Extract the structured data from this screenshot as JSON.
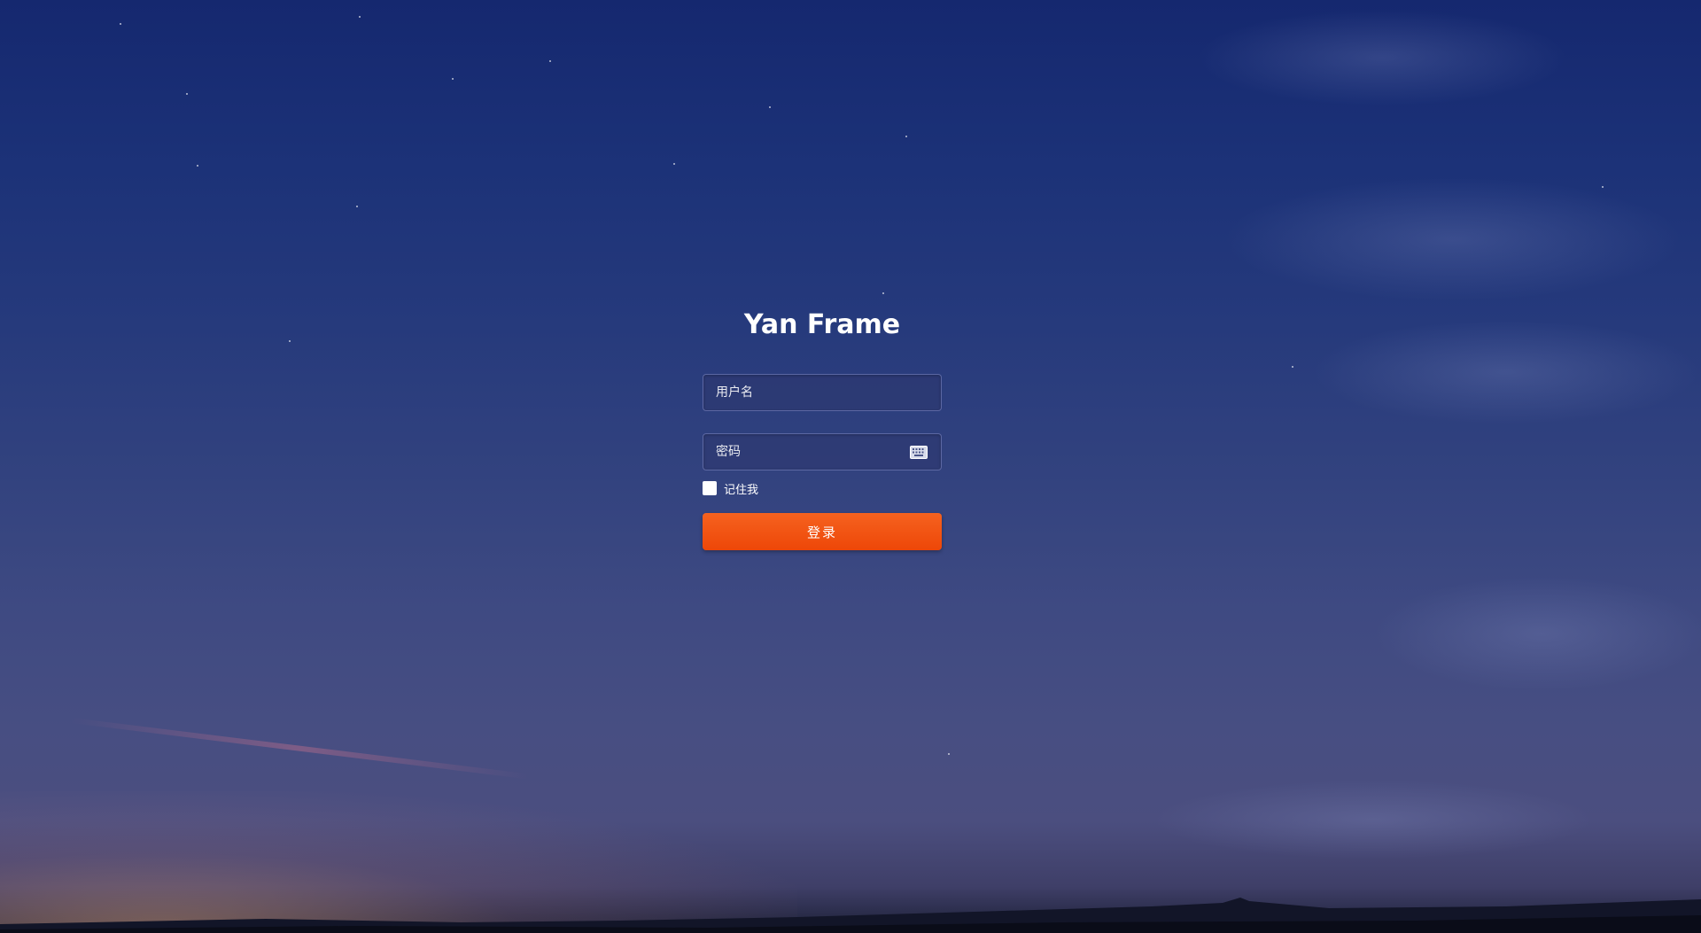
{
  "app": {
    "title": "Yan Frame"
  },
  "form": {
    "username_placeholder": "用户名",
    "password_placeholder": "密码",
    "remember_label": "记住我",
    "remember_checked": false,
    "submit_label": "登录",
    "password_icon": "keyboard-icon"
  },
  "colors": {
    "sky_top": "#15286f",
    "sky_bottom": "#474e82",
    "button": "#f05414",
    "text": "#ffffff"
  }
}
